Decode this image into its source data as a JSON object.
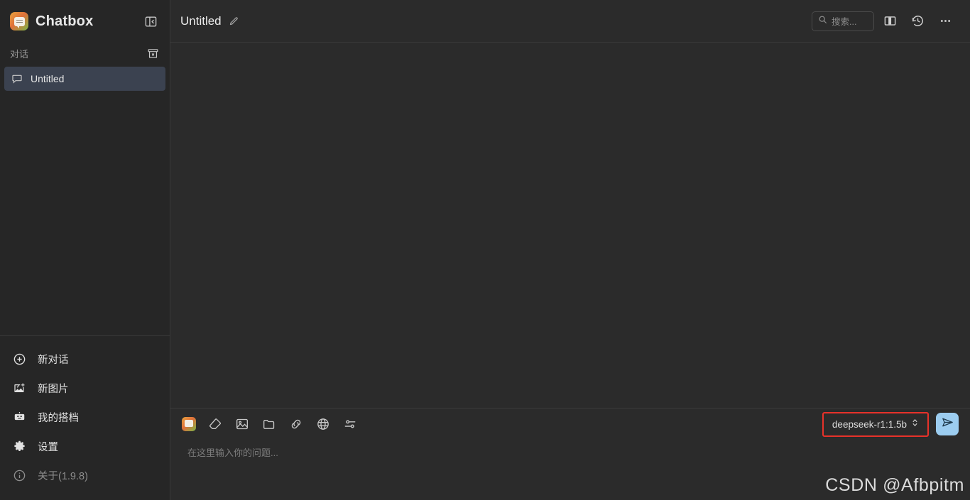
{
  "app": {
    "brand_name": "Chatbox",
    "logo_icon": "chatbox-logo-icon"
  },
  "sidebar": {
    "collapse_icon": "collapse-panel-icon",
    "conversations_label": "对话",
    "archive_icon": "archive-box-icon",
    "conversations": [
      {
        "title": "Untitled",
        "icon": "chat-bubble-icon",
        "selected": true
      }
    ],
    "menu": [
      {
        "label": "新对话",
        "icon": "plus-circle-icon",
        "muted": false
      },
      {
        "label": "新图片",
        "icon": "image-add-icon",
        "muted": false
      },
      {
        "label": "我的搭档",
        "icon": "robot-icon",
        "muted": false
      },
      {
        "label": "设置",
        "icon": "gear-icon",
        "muted": false
      },
      {
        "label": "关于(1.9.8)",
        "icon": "info-circle-icon",
        "muted": true
      }
    ]
  },
  "header": {
    "chat_title": "Untitled",
    "edit_icon": "pencil-icon",
    "search": {
      "placeholder": "搜索...",
      "icon": "search-icon"
    },
    "split_panel_icon": "split-panel-icon",
    "history_icon": "history-clock-icon",
    "more_icon": "ellipsis-icon"
  },
  "composer": {
    "tools": [
      {
        "name": "chatbox-app-icon",
        "label": "Chatbox"
      },
      {
        "name": "eraser-icon",
        "label": "清除"
      },
      {
        "name": "image-icon",
        "label": "图片"
      },
      {
        "name": "folder-icon",
        "label": "文件"
      },
      {
        "name": "link-icon",
        "label": "链接"
      },
      {
        "name": "globe-icon",
        "label": "网页"
      },
      {
        "name": "sliders-icon",
        "label": "参数"
      }
    ],
    "model": {
      "name": "deepseek-r1:1.5b",
      "chevron_icon": "chevron-updown-icon",
      "highlight_color": "#e8322a"
    },
    "send_icon": "send-plane-icon",
    "send_button_color": "#9ccdf0",
    "input_placeholder": "在这里输入你的问题..."
  },
  "watermark": {
    "text": "CSDN @Afbpitm"
  },
  "theme": {
    "sidebar_bg": "#262626",
    "main_bg": "#2b2b2b",
    "selected_row_bg": "#3b4250",
    "divider": "#3a3a3a",
    "text_primary": "#e6e6e6",
    "text_muted": "#8d8d8d"
  }
}
